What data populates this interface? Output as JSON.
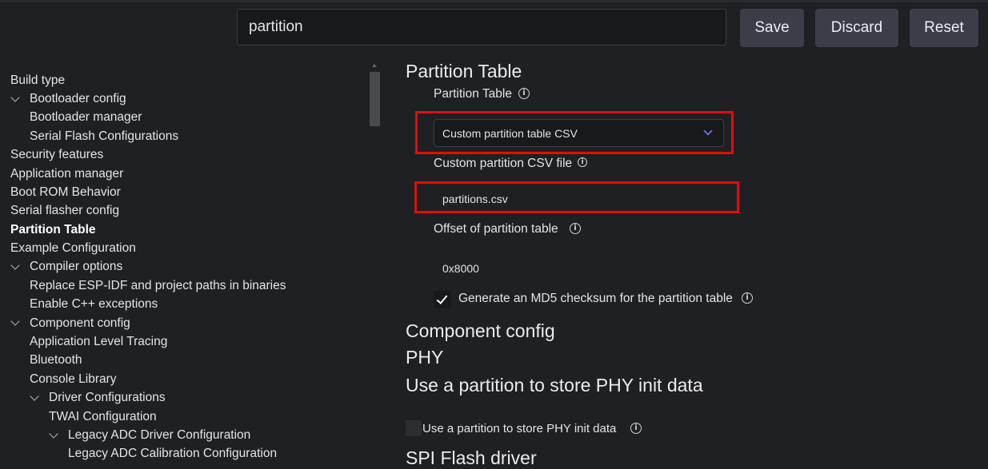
{
  "search": {
    "value": "partition"
  },
  "toolbar": {
    "save_label": "Save",
    "discard_label": "Discard",
    "reset_label": "Reset"
  },
  "sidebar": {
    "items": [
      {
        "label": "Build type",
        "expanded": false
      },
      {
        "label": "Bootloader config",
        "expanded": true
      },
      {
        "label": "Bootloader manager"
      },
      {
        "label": "Serial Flash Configurations"
      },
      {
        "label": "Security features"
      },
      {
        "label": "Application manager"
      },
      {
        "label": "Boot ROM Behavior"
      },
      {
        "label": "Serial flasher config"
      },
      {
        "label": "Partition Table",
        "selected": true
      },
      {
        "label": "Example Configuration"
      },
      {
        "label": "Compiler options",
        "expanded": true
      },
      {
        "label": "Replace ESP-IDF and project paths in binaries"
      },
      {
        "label": "Enable C++ exceptions"
      },
      {
        "label": "Component config",
        "expanded": true
      },
      {
        "label": "Application Level Tracing"
      },
      {
        "label": "Bluetooth"
      },
      {
        "label": "Console Library"
      },
      {
        "label": "Driver Configurations",
        "expanded": true
      },
      {
        "label": "TWAI Configuration"
      },
      {
        "label": "Legacy ADC Driver Configuration",
        "expanded": true
      },
      {
        "label": "Legacy ADC Calibration Configuration"
      }
    ]
  },
  "main": {
    "section_partition_title": "Partition Table",
    "partition_table_label": "Partition Table",
    "partition_table_value": "Custom partition table CSV",
    "custom_csv_label": "Custom partition CSV file",
    "custom_csv_value": "partitions.csv",
    "offset_label": "Offset of partition table",
    "offset_value": "0x8000",
    "md5_label": "Generate an MD5 checksum for the partition table",
    "md5_checked": true,
    "section_component_title": "Component config",
    "section_phy_title": "PHY",
    "section_phy_init_title": "Use a partition to store PHY init data",
    "phy_init_checkbox_label": "Use a partition to store PHY init data",
    "phy_init_checked": false,
    "section_spi_title": "SPI Flash driver"
  },
  "colors": {
    "background": "#1f2023",
    "input_background": "#18191b",
    "button_background": "#3b3d49",
    "highlight_red": "#e10d0d",
    "chevron_accent": "#5a72e8"
  },
  "icons": {
    "info": "info-circle-icon",
    "chevron": "chevron-down-icon",
    "check": "checkmark-icon"
  }
}
